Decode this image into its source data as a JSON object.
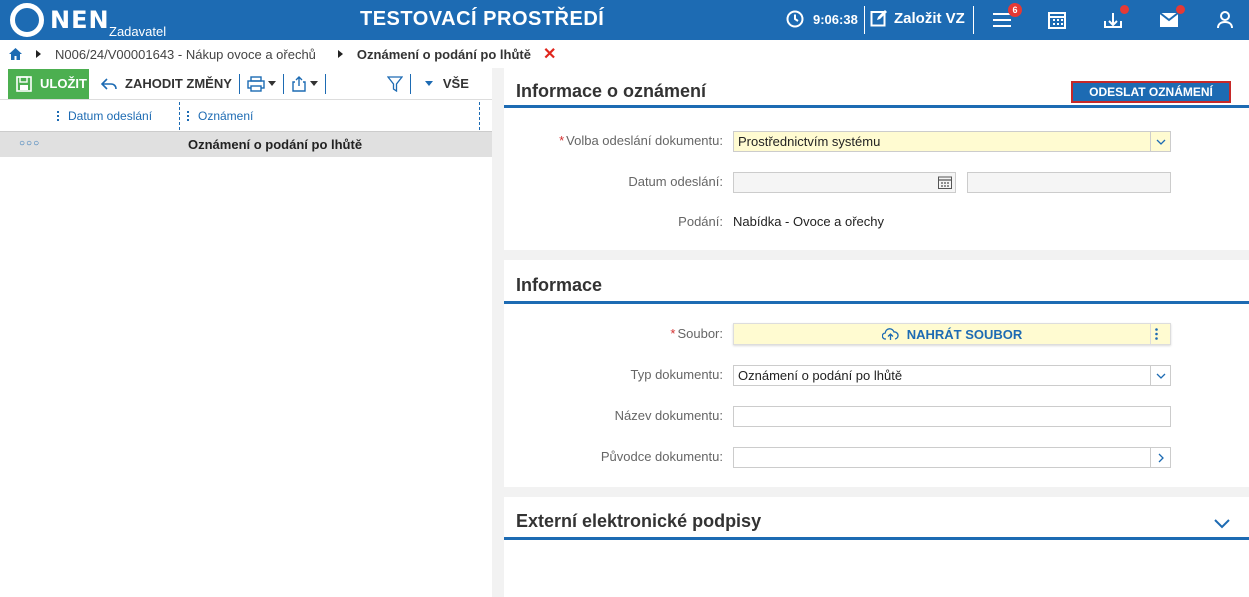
{
  "header": {
    "logo": "NEN",
    "logo_sub": "Zadavatel",
    "env_title": "TESTOVACÍ PROSTŘEDÍ",
    "time": "9:06:38",
    "create_label": "Založit VZ",
    "menu_badge": "6",
    "colors": {
      "bar": "#1d6bb3",
      "badge": "#e53935"
    }
  },
  "breadcrumb": {
    "item1": "N006/24/V00001643 - Nákup ovoce a ořechů",
    "current": "Oznámení o podání po lhůtě",
    "close": "✕"
  },
  "toolbar": {
    "save_label": "ULOŽIT",
    "discard_label": "ZAHODIT ZMĚNY",
    "filter_all": "VŠE"
  },
  "grid": {
    "columns": [
      "Datum odeslání",
      "Oznámení"
    ],
    "rows": [
      {
        "date": "",
        "notice": "Oznámení o podání po lhůtě"
      }
    ]
  },
  "section1": {
    "title": "Informace o oznámení",
    "send_button": "ODESLAT OZNÁMENÍ",
    "send_method_label": "Volba odeslání dokumentu:",
    "send_method_value": "Prostřednictvím systému",
    "date_label": "Datum odeslání:",
    "date_value": "",
    "submission_label": "Podání:",
    "submission_value": "Nabídka - Ovoce a ořechy"
  },
  "section2": {
    "title": "Informace",
    "file_label": "Soubor:",
    "upload_label": "NAHRÁT SOUBOR",
    "doc_type_label": "Typ dokumentu:",
    "doc_type_value": "Oznámení o podání po lhůtě",
    "doc_name_label": "Název dokumentu:",
    "doc_name_value": "",
    "author_label": "Původce dokumentu:",
    "author_value": ""
  },
  "section3": {
    "title": "Externí elektronické podpisy"
  }
}
